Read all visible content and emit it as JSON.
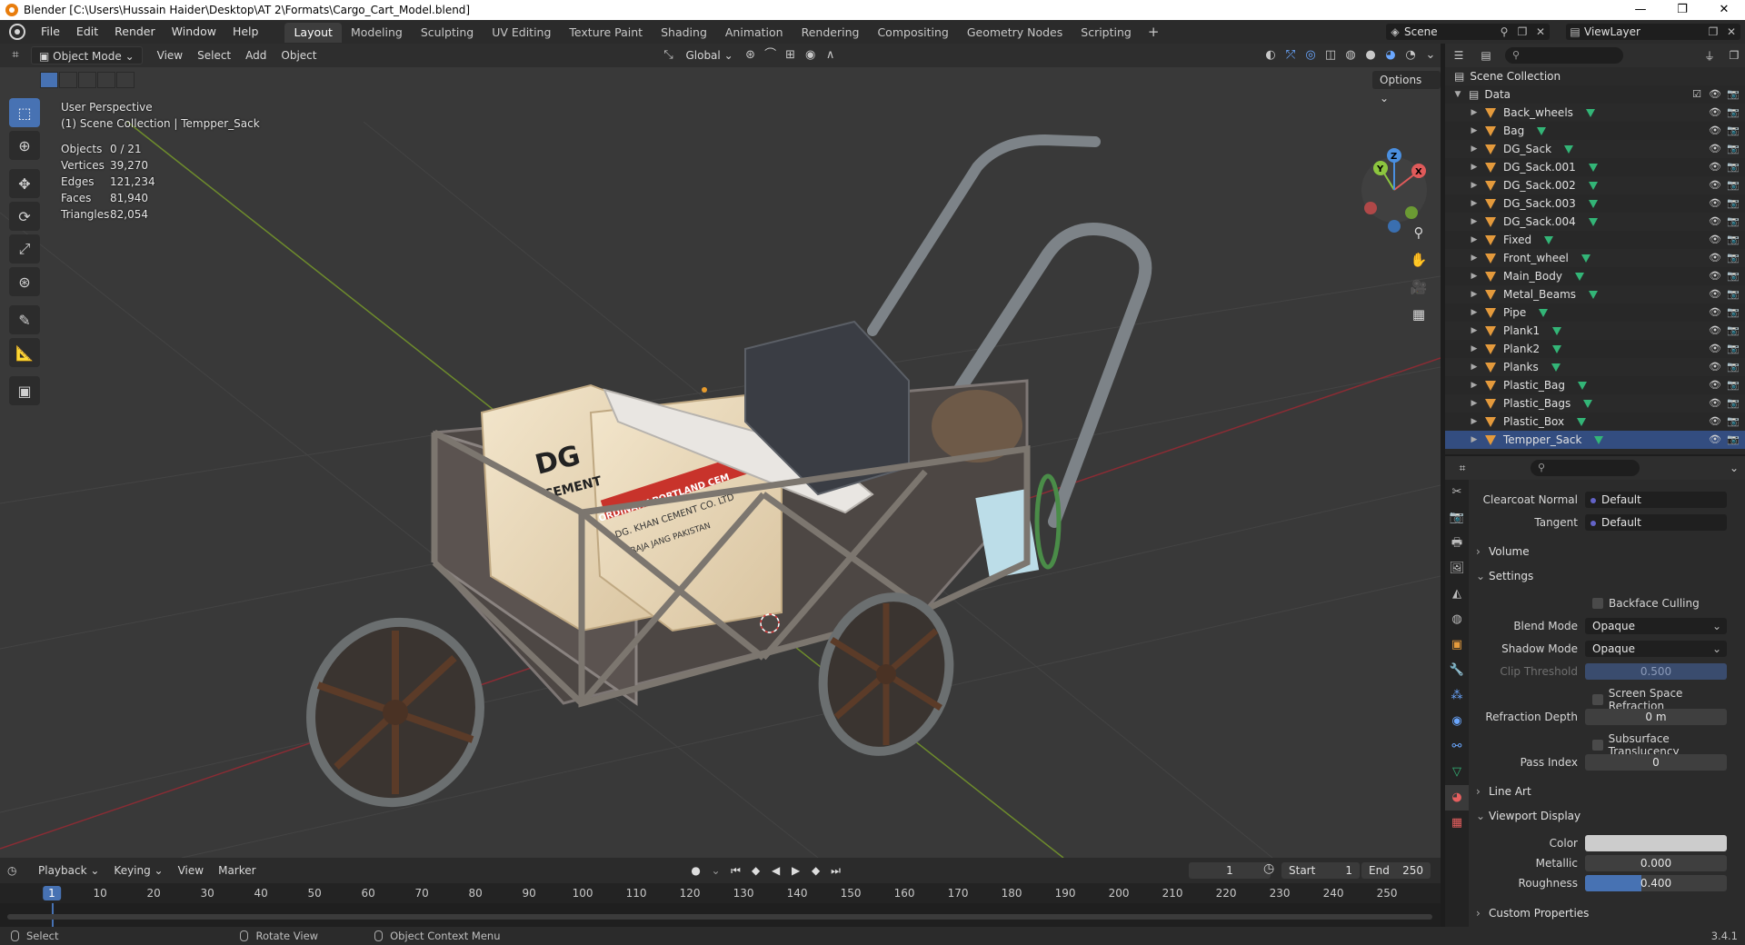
{
  "window": {
    "title": "Blender [C:\\Users\\Hussain Haider\\Desktop\\AT 2\\Formats\\Cargo_Cart_Model.blend]",
    "minimize": "—",
    "maximize": "❐",
    "close": "✕"
  },
  "menubar": {
    "items": [
      "File",
      "Edit",
      "Render",
      "Window",
      "Help"
    ],
    "workspaces": [
      "Layout",
      "Modeling",
      "Sculpting",
      "UV Editing",
      "Texture Paint",
      "Shading",
      "Animation",
      "Rendering",
      "Compositing",
      "Geometry Nodes",
      "Scripting"
    ],
    "active_workspace": "Layout",
    "add_symbol": "+",
    "scene": "Scene",
    "view_layer": "ViewLayer"
  },
  "viewport": {
    "mode": "Object Mode",
    "menus": [
      "View",
      "Select",
      "Add",
      "Object"
    ],
    "transform_orientation": "Global",
    "options": "Options",
    "perspective": "User Perspective",
    "collection_path": "(1) Scene Collection | Tempper_Sack",
    "stats": [
      {
        "label": "Objects",
        "value": "0 / 21"
      },
      {
        "label": "Vertices",
        "value": "39,270"
      },
      {
        "label": "Edges",
        "value": "121,234"
      },
      {
        "label": "Faces",
        "value": "81,940"
      },
      {
        "label": "Triangles",
        "value": "82,054"
      }
    ],
    "gizmo": {
      "x": "X",
      "y": "Y",
      "z": "Z"
    },
    "cart_text": {
      "sack_brand": "DG",
      "sack_sub": "CEMENT",
      "sack_line1": "ORDINARY PORTLAND CEM",
      "sack_line2": "DG. KHAN CEMENT CO. LTD",
      "sack_line3": "RAJA JANG PAKISTAN"
    }
  },
  "timeline": {
    "menus": [
      "Playback",
      "Keying",
      "View",
      "Marker"
    ],
    "current_frame": "1",
    "start_label": "Start",
    "start": "1",
    "end_label": "End",
    "end": "250",
    "ticks": [
      "10",
      "20",
      "30",
      "40",
      "50",
      "60",
      "70",
      "80",
      "90",
      "100",
      "110",
      "120",
      "130",
      "140",
      "150",
      "160",
      "170",
      "180",
      "190",
      "200",
      "210",
      "220",
      "230",
      "240",
      "250"
    ],
    "ruler_current": "1"
  },
  "statusbar": {
    "items": [
      "Select",
      "Rotate View",
      "Object Context Menu"
    ],
    "version": "3.4.1"
  },
  "outliner": {
    "root": "Scene Collection",
    "collection": "Data",
    "objects": [
      "Back_wheels",
      "Bag",
      "DG_Sack",
      "DG_Sack.001",
      "DG_Sack.002",
      "DG_Sack.003",
      "DG_Sack.004",
      "Fixed",
      "Front_wheel",
      "Main_Body",
      "Metal_Beams",
      "Pipe",
      "Plank1",
      "Plank2",
      "Planks",
      "Plastic_Bag",
      "Plastic_Bags",
      "Plastic_Box",
      "Tempper_Sack"
    ],
    "selected": "Tempper_Sack"
  },
  "properties": {
    "clearcoat_normal_label": "Clearcoat Normal",
    "clearcoat_normal": "Default",
    "tangent_label": "Tangent",
    "tangent": "Default",
    "volume": "Volume",
    "settings": "Settings",
    "backface_culling": "Backface Culling",
    "blend_mode_label": "Blend Mode",
    "blend_mode": "Opaque",
    "shadow_mode_label": "Shadow Mode",
    "shadow_mode": "Opaque",
    "clip_threshold_label": "Clip Threshold",
    "clip_threshold": "0.500",
    "screen_space_refraction": "Screen Space Refraction",
    "refraction_depth_label": "Refraction Depth",
    "refraction_depth": "0 m",
    "subsurface_translucency": "Subsurface Translucency",
    "pass_index_label": "Pass Index",
    "pass_index": "0",
    "line_art": "Line Art",
    "viewport_display": "Viewport Display",
    "color_label": "Color",
    "metallic_label": "Metallic",
    "metallic": "0.000",
    "roughness_label": "Roughness",
    "roughness": "0.400",
    "roughness_fraction": 0.4,
    "custom_properties": "Custom Properties"
  },
  "colors": {
    "accent": "#4772b3",
    "viewport_bg": "#393939",
    "object_icon": "#e49a3c",
    "mesh_icon": "#33b577",
    "x_axis": "#e05a5a",
    "y_axis": "#8cc63f",
    "z_axis": "#4a8fe0"
  }
}
